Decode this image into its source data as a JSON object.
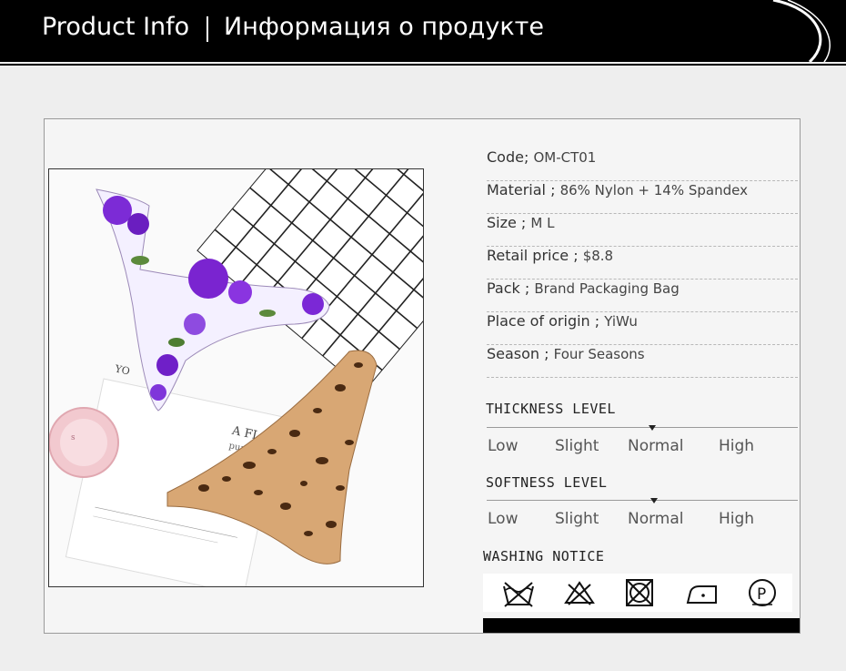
{
  "header": {
    "title": "Product Info",
    "title_ru": "Информация о продукте"
  },
  "info": [
    {
      "label": "Code;",
      "value": "OM-CT01"
    },
    {
      "label": "Material ;",
      "value": "86% Nylon + 14% Spandex"
    },
    {
      "label": "Size ;",
      "value": "M L"
    },
    {
      "label": "Retail price ;",
      "value": "$8.8"
    },
    {
      "label": "Pack ;",
      "value": "Brand Packaging Bag"
    },
    {
      "label": "Place of origin ;",
      "value": "YiWu"
    },
    {
      "label": "Season ;",
      "value": "Four Seasons"
    }
  ],
  "thickness": {
    "title": "THICKNESS LEVEL",
    "levels": [
      "Low",
      "Slight",
      "Normal",
      "High"
    ],
    "selected": "Normal"
  },
  "softness": {
    "title": "SOFTNESS LEVEL",
    "levels": [
      "Low",
      "Slight",
      "Normal",
      "High"
    ],
    "selected": "Normal"
  },
  "washing": {
    "title": "WASHING NOTICE",
    "icons": [
      "do-not-wash-icon",
      "do-not-bleach-icon",
      "do-not-tumble-dry-icon",
      "iron-low-heat-icon",
      "dry-clean-p-icon"
    ]
  },
  "photo": {
    "card_text_1": "A FLOWER",
    "card_text_2": "pure and fair",
    "card_text_3": "YO"
  }
}
